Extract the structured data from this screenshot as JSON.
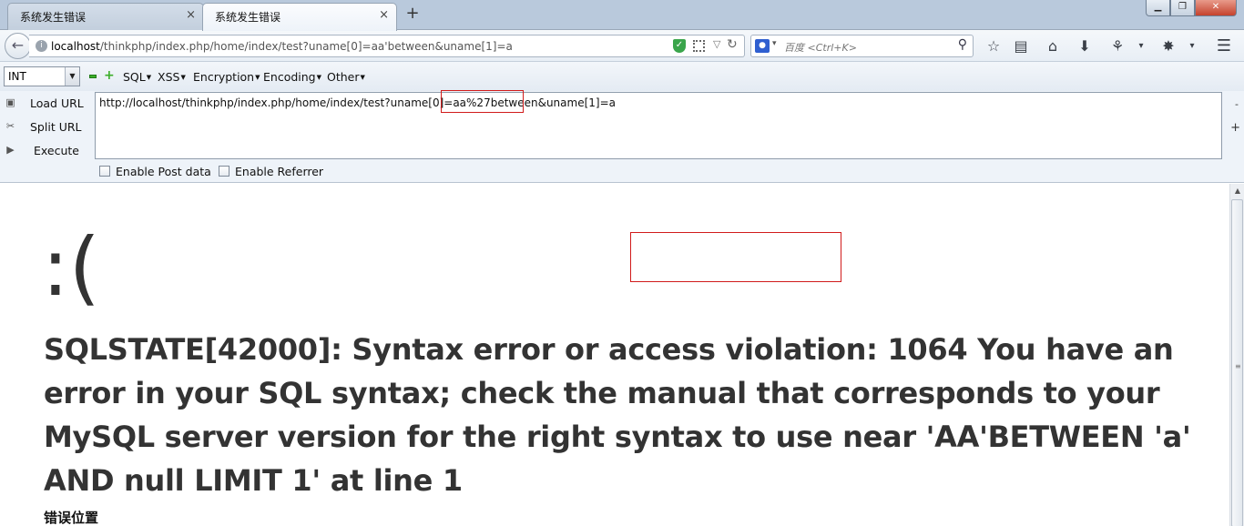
{
  "browser": {
    "tabs": [
      {
        "title": "系统发生错误",
        "close": "×",
        "active": false
      },
      {
        "title": "系统发生错误",
        "close": "×",
        "active": true
      }
    ],
    "new_tab": "+",
    "window_controls": {
      "minimize": "▁",
      "maximize": "❐",
      "close": "✕"
    },
    "url": {
      "host": "localhost",
      "path": "/thinkphp/index.php/home/index/test?uname[0]=aa'between&uname[1]=a"
    },
    "search": {
      "engine_icon": "paw-icon",
      "placeholder": "百度 <Ctrl+K>"
    },
    "toolbar_icons": [
      "star-icon",
      "reading-list-icon",
      "home-icon",
      "download-icon",
      "extension-icon",
      "menu-icon"
    ]
  },
  "hackbar": {
    "select_value": "INT",
    "menus": [
      "SQL",
      "XSS",
      "Encryption",
      "Encoding",
      "Other"
    ],
    "actions": [
      {
        "label": "Load URL",
        "icon": "load-icon"
      },
      {
        "label": "Split URL",
        "icon": "scissors-icon"
      },
      {
        "label": "Execute",
        "icon": "play-icon"
      }
    ],
    "url_value": "http://localhost/thinkphp/index.php/home/index/test?uname[0]=aa%27between&uname[1]=a",
    "side_minus": "-",
    "side_plus": "+",
    "checkboxes": [
      {
        "label": "Enable Post data",
        "checked": false
      },
      {
        "label": "Enable Referrer",
        "checked": false
      }
    ]
  },
  "page": {
    "face": ":(",
    "error_message": "SQLSTATE[42000]: Syntax error or access violation: 1064 You have an error in your SQL syntax; check the manual that corresponds to your MySQL server version for the right syntax to use near 'AA'BETWEEN 'a' AND null LIMIT 1' at line 1",
    "error_location_label": "错误位置"
  },
  "colors": {
    "highlight_box": "#d11b1b",
    "error_text": "#333333",
    "tabstrip_bg": "#b9c9dc"
  }
}
